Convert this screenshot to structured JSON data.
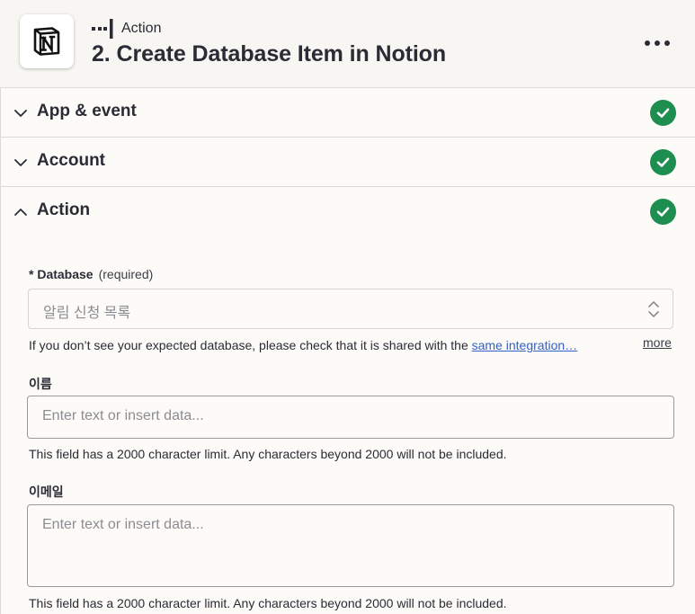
{
  "header": {
    "step_kind": "Action",
    "title": "2. Create Database Item in Notion",
    "app_icon": "notion-logo-icon",
    "menu_icon": "more-horizontal-icon"
  },
  "sections": [
    {
      "label": "App & event",
      "state": "collapsed",
      "complete": true
    },
    {
      "label": "Account",
      "state": "collapsed",
      "complete": true
    },
    {
      "label": "Action",
      "state": "expanded",
      "complete": true
    }
  ],
  "form": {
    "database": {
      "label": "* Database",
      "required_text": "(required)",
      "value": "알림 신청 목록",
      "help_text": "If you don’t see your expected database, please check that it is shared with the ",
      "help_link": "same integration…",
      "more_link": "more"
    },
    "name_field": {
      "label": "이름",
      "placeholder": "Enter text or insert data...",
      "help": "This field has a 2000 character limit. Any characters beyond 2000 will not be included."
    },
    "email_field": {
      "label": "이메일",
      "placeholder": "Enter text or insert data...",
      "help": "This field has a 2000 character limit. Any characters beyond 2000 will not be included."
    }
  },
  "colors": {
    "check_green": "#1e8e50",
    "link_blue": "#3461c9",
    "header_bg": "#f7f6f2",
    "page_bg": "#fcfbf7"
  }
}
